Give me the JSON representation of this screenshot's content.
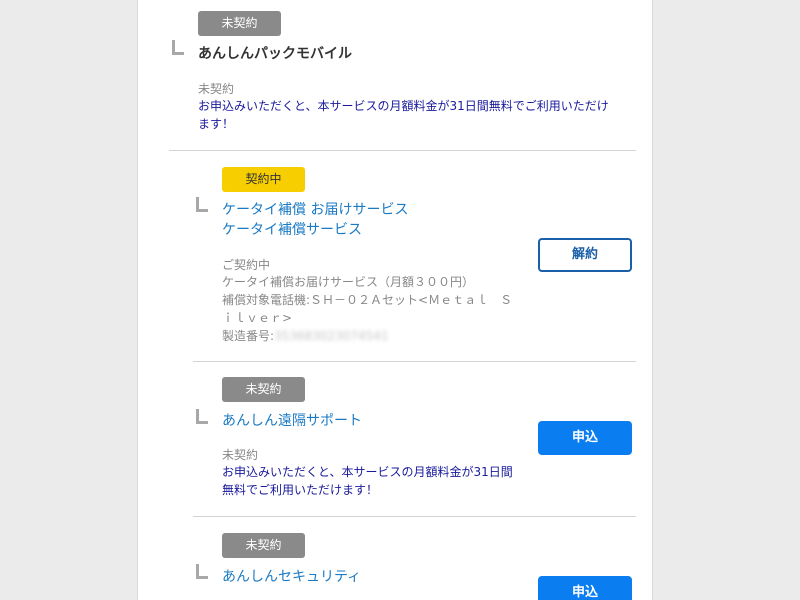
{
  "colors": {
    "background": "#ebebeb",
    "panel": "#ffffff",
    "badge_gray": "#8a8a8a",
    "badge_yellow": "#f7cf00",
    "link_blue": "#1a7ac4",
    "desc_navy": "#1a1a9c",
    "button_blue": "#0a7df0",
    "button_outline": "#1a5fa8"
  },
  "services": [
    {
      "badge": "未契約",
      "title": "あんしんパックモバイル",
      "status": "未契約",
      "description": "お申込みいただくと、本サービスの月額料金が31日間無料でご利用いただけます！"
    },
    {
      "badge": "契約中",
      "title_line1": "ケータイ補償 お届けサービス",
      "title_line2": "ケータイ補償サービス",
      "status": "ご契約中",
      "detail_plan": "ケータイ補償お届けサービス（月額３００円）",
      "detail_device_line1": "補償対象電話機:ＳＨ－０２Ａセット<Ｍｅｔａｌ　Ｓ",
      "detail_device_line2": "ｉｌｖｅｒ>",
      "serial_label": "製造番号:",
      "serial_value": "353683023074541",
      "button": "解約"
    },
    {
      "badge": "未契約",
      "title": "あんしん遠隔サポート",
      "status": "未契約",
      "description_line1": "お申込みいただくと、本サービスの月額料金が31日間",
      "description_line2": "無料でご利用いただけます！",
      "button": "申込"
    },
    {
      "badge": "未契約",
      "title": "あんしんセキュリティ",
      "button": "申込"
    }
  ]
}
